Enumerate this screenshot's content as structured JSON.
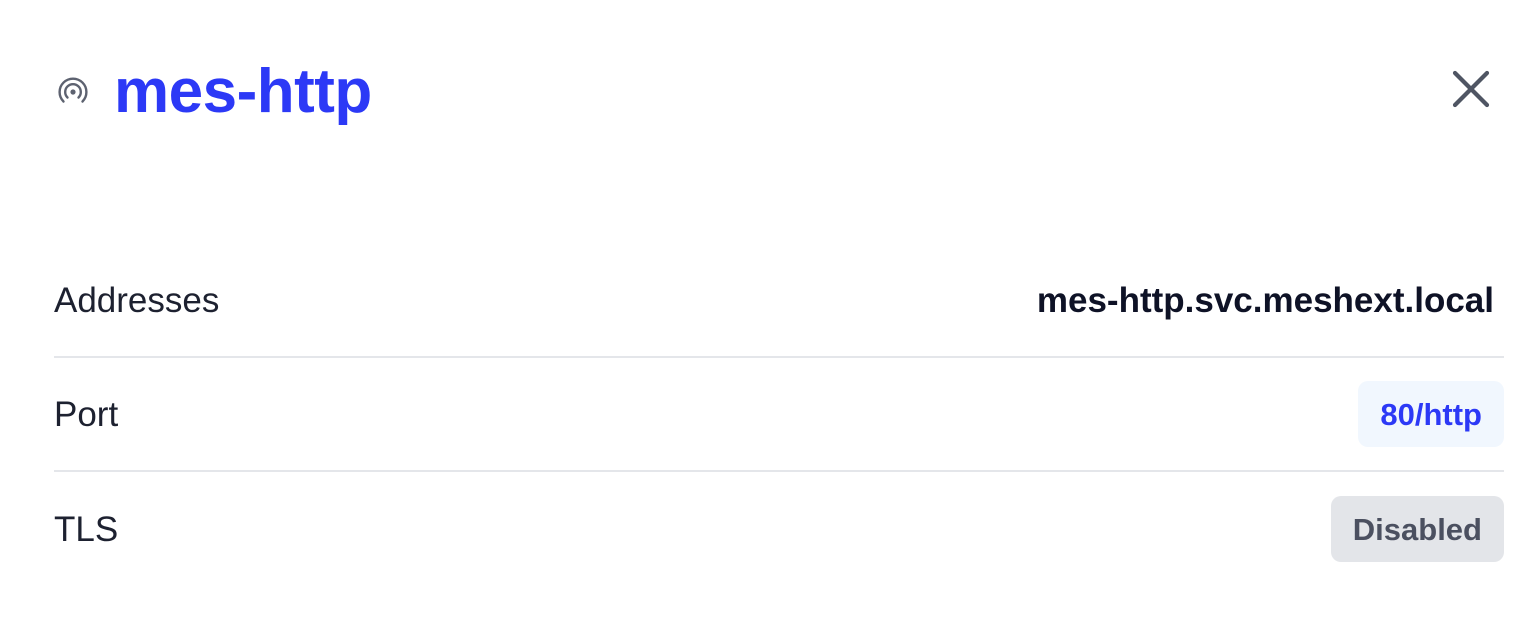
{
  "header": {
    "title": "mes-http",
    "icon": "broadcast-icon",
    "close_icon": "close-icon"
  },
  "details": [
    {
      "label": "Addresses",
      "value": "mes-http.svc.meshext.local"
    },
    {
      "label": "Port",
      "value": "80/http"
    },
    {
      "label": "TLS",
      "value": "Disabled"
    }
  ],
  "colors": {
    "title": "#2c39f6",
    "port_badge_bg": "#f1f7fe",
    "port_badge_text": "#2c39f6",
    "tls_badge_bg": "#e3e5e9",
    "tls_badge_text": "#4b5060"
  }
}
